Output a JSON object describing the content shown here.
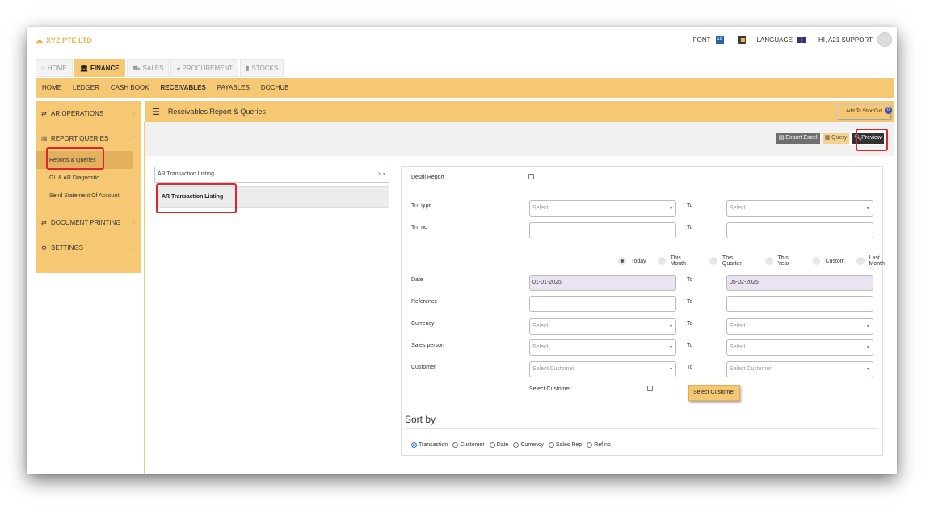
{
  "brand": {
    "name": "XYZ PTE LTD"
  },
  "topbar": {
    "font_label": "FONT",
    "language_label": "LANGUAGE",
    "greeting": "HI, A21 SUPPORT"
  },
  "module_tabs": [
    {
      "label": "HOME",
      "icon": "home-icon"
    },
    {
      "label": "FINANCE",
      "icon": "bank-icon"
    },
    {
      "label": "SALES",
      "icon": "cart-icon"
    },
    {
      "label": "PROCUREMENT",
      "icon": "tag-icon"
    },
    {
      "label": "STOCKS",
      "icon": "bar-chart-icon"
    }
  ],
  "submenu": [
    "HOME",
    "LEDGER",
    "CASH BOOK",
    "RECEIVABLES",
    "PAYABLES",
    "DOCHUB"
  ],
  "sidebar": {
    "ar_operations": "AR OPERATIONS",
    "report_queries": "REPORT QUERIES",
    "items": [
      "Reports & Queries",
      "GL & AR Diagnostic",
      "Send Statement Of Account"
    ],
    "document_printing": "DOCUMENT PRINTING",
    "settings": "SETTINGS"
  },
  "content": {
    "title": "Receivables Report & Queries",
    "shortcut_label": "Add To ShortCut",
    "shortcut_count": "0",
    "export_label": "Export Excel",
    "query_label": "Query",
    "preview_label": "Preview"
  },
  "report": {
    "selected": "AR Transaction Listing",
    "list_item": "AR Transaction Listing"
  },
  "form": {
    "detail_report": "Detail Report",
    "trn_type": "Trn type",
    "trn_no": "Trn no",
    "to": "To",
    "select": "Select",
    "date_label": "Date",
    "date_from": "01-01-2025",
    "date_to": "05-02-2025",
    "reference": "Reference",
    "currency": "Currency",
    "sales_person": "Sales person",
    "customer": "Customer",
    "select_customer_placeholder": "Select Customer",
    "select_customer_check": "Select Customer",
    "select_customer_button": "Select Customer",
    "date_ranges": [
      "Today",
      "This Month",
      "This Quarter",
      "This Year",
      "Custom",
      "Last Month"
    ],
    "sort_by": "Sort by",
    "sort_options": [
      "Transaction",
      "Customer",
      "Date",
      "Currency",
      "Sales Rep",
      "Ref no"
    ]
  }
}
